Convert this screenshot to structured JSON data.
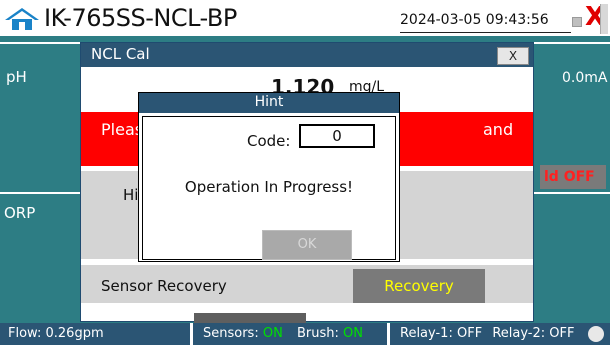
{
  "header": {
    "app_title": "IK-765SS-NCL-BP",
    "datetime": "2024-03-05 09:43:56",
    "close_label": "X"
  },
  "dashboard": {
    "ph_label": "pH",
    "ph_current": "0.0mA",
    "orp_label": "ORP",
    "hold_button_partial": "ld OFF"
  },
  "ncl_window": {
    "title": "NCL Cal",
    "close_label": "X",
    "reading_value": "1.120",
    "reading_unit": "mg/L",
    "red_text_left": "Pleas",
    "red_text_right": "and",
    "grey_label_partial": "Hi",
    "sensor_recovery_label": "Sensor Recovery",
    "recovery_button_label": "Recovery"
  },
  "hint_dialog": {
    "title": "Hint",
    "code_label": "Code:",
    "code_value": "0",
    "message": "Operation In Progress!",
    "ok_label": "OK"
  },
  "status_bar": {
    "flow_label": "Flow:",
    "flow_value": "0.26gpm",
    "sensors_label": "Sensors:",
    "sensors_value": "ON",
    "brush_label": "Brush:",
    "brush_value": "ON",
    "relay1_label": "Relay-1:",
    "relay1_value": "OFF",
    "relay2_label": "Relay-2:",
    "relay2_value": "OFF"
  },
  "colors": {
    "dashboard_bg": "#2d7d84",
    "titlebar_bg": "#2b5574",
    "alert_red": "#ff0000",
    "active_green": "#00e000",
    "recovery_text": "#ffff00"
  },
  "icons": {
    "home": "home-icon",
    "window": "window-icon",
    "close": "close-icon",
    "status": "status-circle-icon"
  }
}
